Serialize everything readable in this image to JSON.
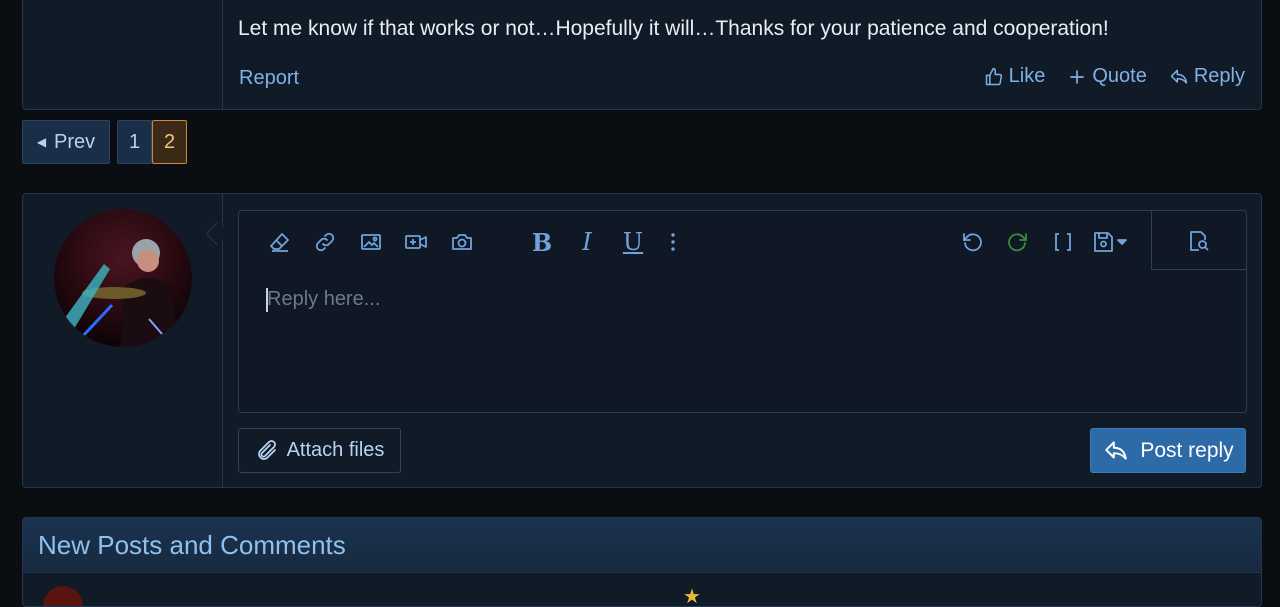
{
  "post": {
    "text": "Let me know if that works or not…Hopefully it will…Thanks for your patience and cooperation!",
    "report_label": "Report",
    "like_label": "Like",
    "quote_label": "Quote",
    "reply_label": "Reply"
  },
  "pagination": {
    "prev_label": "Prev",
    "pages": [
      "1",
      "2"
    ],
    "current_page": "2"
  },
  "editor": {
    "placeholder": "Reply here...",
    "toolbar": {
      "bold": "B",
      "italic": "I",
      "underline": "U",
      "icons": [
        "eraser-icon",
        "link-icon",
        "image-icon",
        "video-icon",
        "camera-icon",
        "bold-icon",
        "italic-icon",
        "underline-icon",
        "more-icon",
        "undo-icon",
        "redo-icon",
        "brackets-icon",
        "save-draft-icon",
        "preview-icon"
      ]
    },
    "attach_label": "Attach files",
    "submit_label": "Post reply"
  },
  "new_posts": {
    "title": "New Posts and Comments"
  },
  "colors": {
    "background": "#0a0d12",
    "panel": "#111b28",
    "border": "#22364d",
    "link": "#7fb0e6",
    "accent_button": "#2d6aa8",
    "current_page": "#c58a3a",
    "redo_icon": "#3f8a3f"
  }
}
